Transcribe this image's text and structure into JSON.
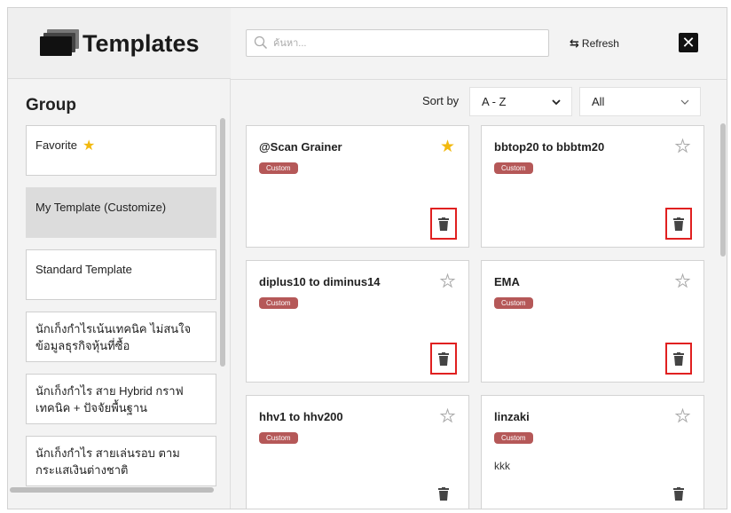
{
  "app": {
    "title": "Templates"
  },
  "sidebar": {
    "heading": "Group",
    "items": [
      {
        "label": "Favorite",
        "starred": true
      },
      {
        "label": "My Template (Customize)",
        "selected": true
      },
      {
        "label": "Standard Template"
      },
      {
        "label": "นักเก็งกำไรเน้นเทคนิค ไม่สนใจข้อมูลธุรกิจหุ้นที่ซื้อ"
      },
      {
        "label": "นักเก็งกำไร สาย Hybrid กราฟเทคนิค + ปัจจัยพื้นฐาน"
      },
      {
        "label": "นักเก็งกำไร สายเล่นรอบ ตามกระแสเงินต่างชาติ"
      }
    ]
  },
  "toolbar": {
    "search_placeholder": "ค้นหา...",
    "refresh_label": "Refresh",
    "close_label": "✕"
  },
  "filters": {
    "sort_label": "Sort by",
    "sort_value": "A - Z",
    "filter_value": "All"
  },
  "cards": [
    {
      "title": "@Scan Grainer",
      "badge": "Custom",
      "starred": true,
      "desc": "",
      "trash_highlight": true
    },
    {
      "title": "bbtop20 to bbbtm20",
      "badge": "Custom",
      "starred": false,
      "desc": "",
      "trash_highlight": true
    },
    {
      "title": "diplus10 to diminus14",
      "badge": "Custom",
      "starred": false,
      "desc": "",
      "trash_highlight": true
    },
    {
      "title": "EMA",
      "badge": "Custom",
      "starred": false,
      "desc": "",
      "trash_highlight": true
    },
    {
      "title": "hhv1 to hhv200",
      "badge": "Custom",
      "starred": false,
      "desc": "",
      "trash_highlight": false
    },
    {
      "title": "linzaki",
      "badge": "Custom",
      "starred": false,
      "desc": "kkk",
      "trash_highlight": false
    }
  ],
  "colors": {
    "badge": "#b55858",
    "star": "#f2b90f",
    "highlight": "#e02020",
    "selected_group": "#dcdcdc"
  },
  "icons": {
    "star": "star-icon",
    "trash": "trash-icon",
    "search": "search-icon",
    "refresh": "refresh-icon",
    "close": "close-icon",
    "chevron": "chevron-down-icon"
  }
}
